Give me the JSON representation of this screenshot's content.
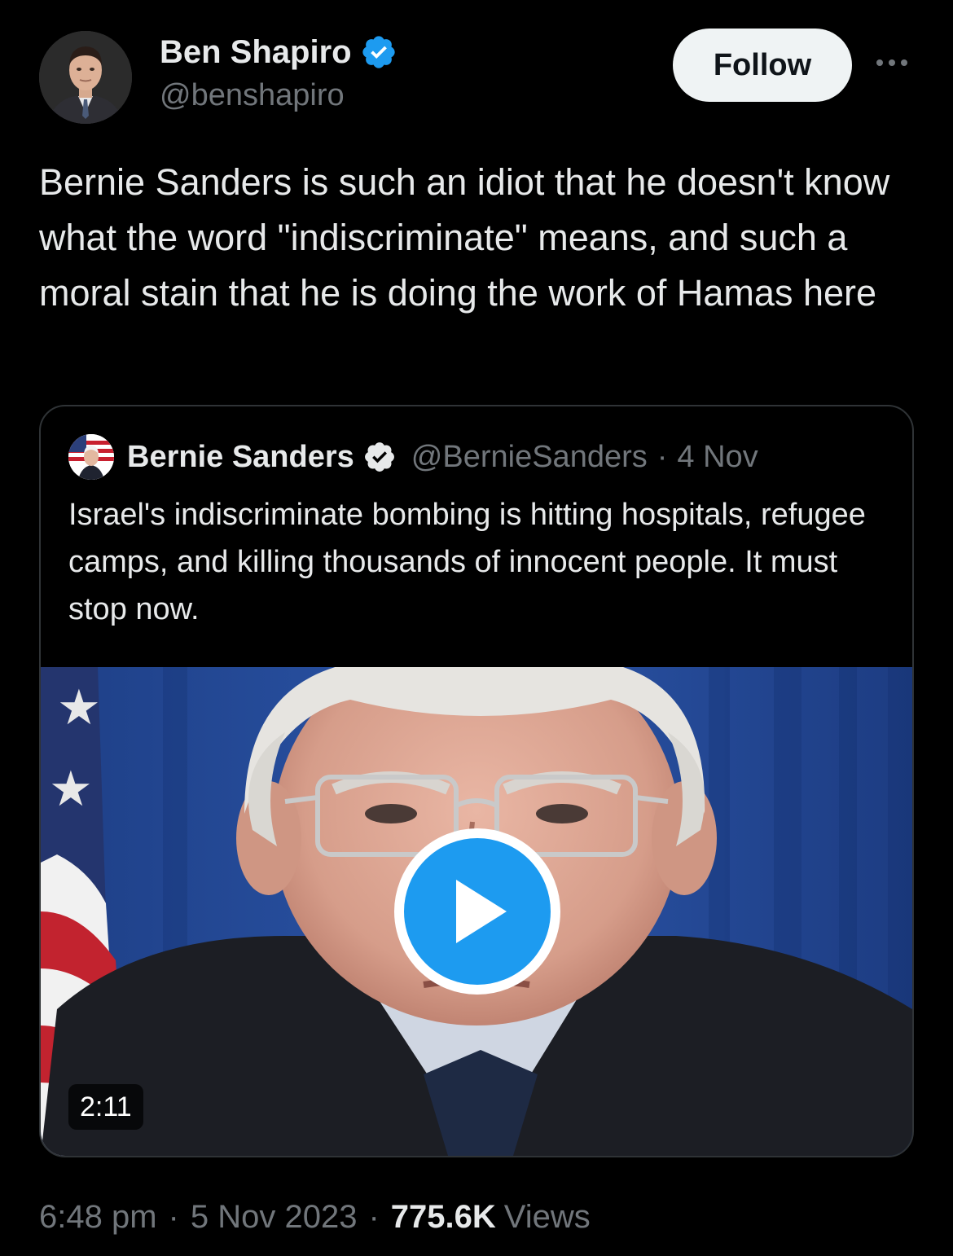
{
  "tweet": {
    "author": {
      "name": "Ben Shapiro",
      "handle": "@benshapiro",
      "verified": true,
      "avatar_icon": "profile-photo"
    },
    "follow_label": "Follow",
    "more_icon": "more-horizontal-icon",
    "text": "Bernie Sanders is such an idiot that he doesn't know what the word \"indiscriminate\" means, and such a moral stain that he is doing the work of Hamas here",
    "quoted": {
      "author_name": "Bernie Sanders",
      "verified": true,
      "handle": "@BernieSanders",
      "separator": "·",
      "date": "4 Nov",
      "text": "Israel's indiscriminate bombing is hitting hospitals, refugee camps, and killing thousands of innocent people. It must stop now.",
      "video": {
        "duration": "2:11",
        "play_icon": "play-icon"
      }
    },
    "timestamp": {
      "time": "6:48 pm",
      "separator": "·",
      "date": "5 Nov 2023",
      "separator2": "·",
      "views_count": "775.6K",
      "views_label": "Views"
    }
  },
  "colors": {
    "background": "#000000",
    "text_primary": "#e7e9ea",
    "text_secondary": "#71767b",
    "verified_blue": "#1d9bf0",
    "follow_button_bg": "#eff3f4",
    "border": "#2f3336"
  }
}
